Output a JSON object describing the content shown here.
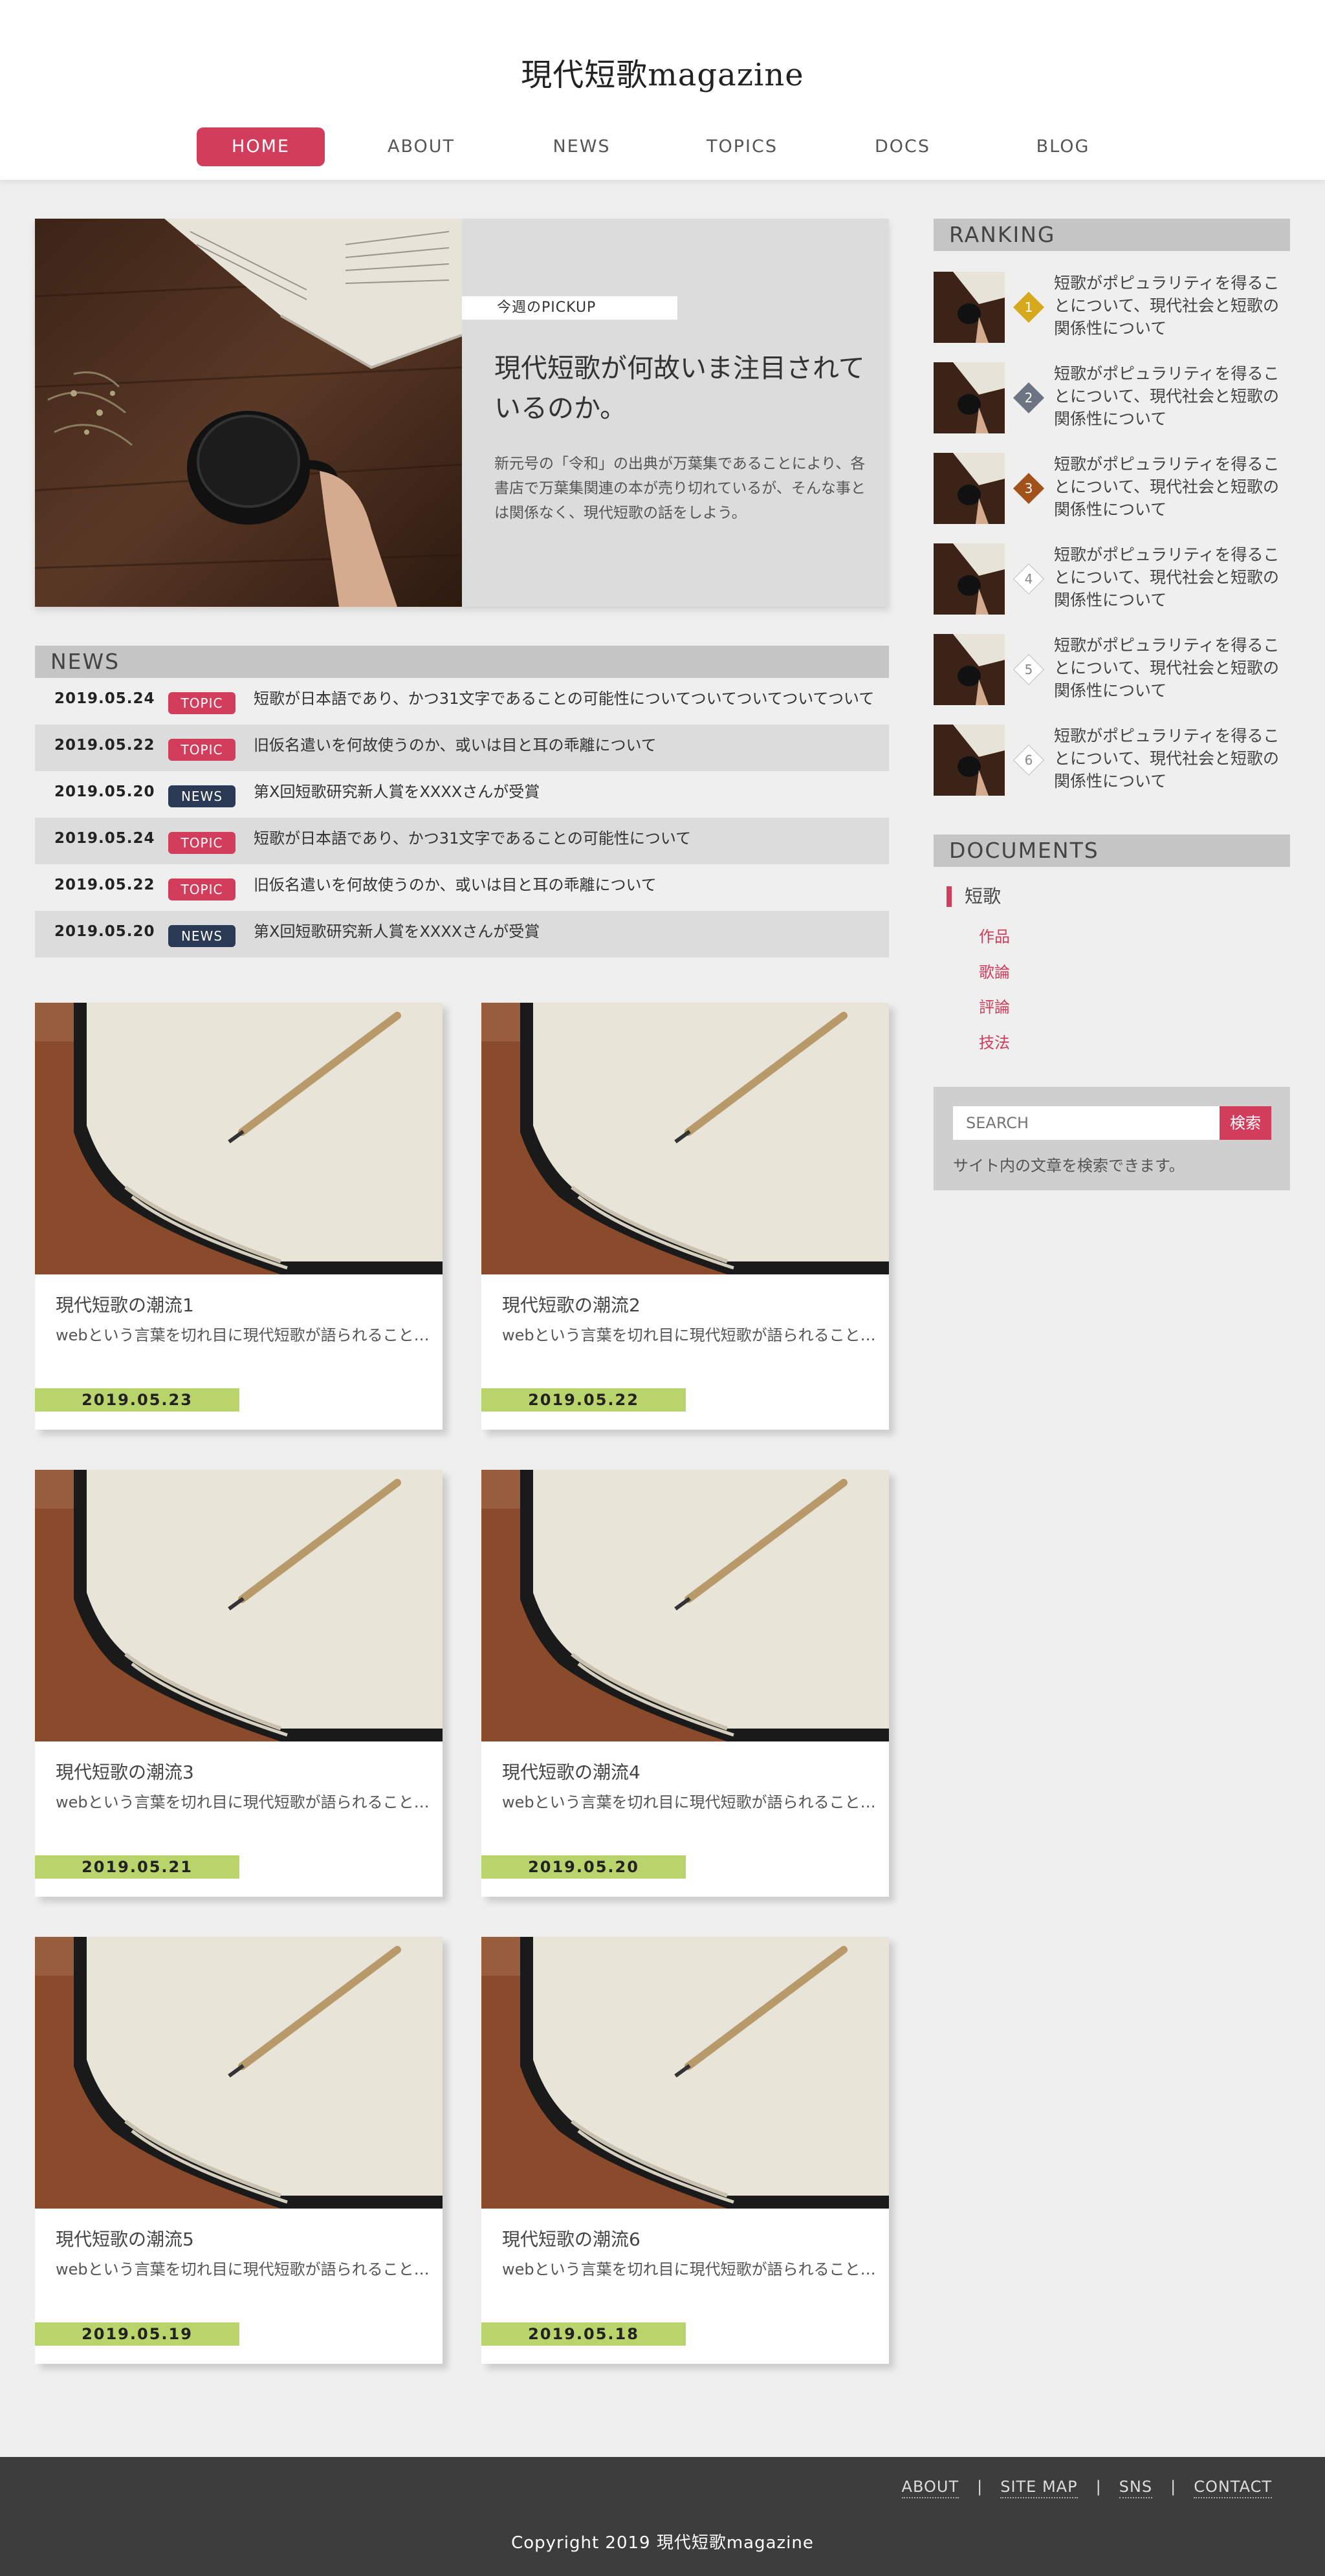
{
  "site": {
    "title": "現代短歌magazine"
  },
  "nav": [
    "HOME",
    "ABOUT",
    "NEWS",
    "TOPICS",
    "DOCS",
    "BLOG"
  ],
  "pickup": {
    "tag": "今週のPICKUP",
    "headline": "現代短歌が何故いま注目されているのか。",
    "description": "新元号の「令和」の出典が万葉集であることにより、各書店で万葉集関連の本が売り切れているが、そんな事とは関係なく、現代短歌の話をしよう。"
  },
  "news": {
    "heading": "NEWS",
    "items": [
      {
        "date": "2019.05.24",
        "badge": "TOPIC",
        "text": "短歌が日本語であり、かつ31文字であることの可能性についてついてついてついてついて"
      },
      {
        "date": "2019.05.22",
        "badge": "TOPIC",
        "text": "旧仮名遣いを何故使うのか、或いは目と耳の乖離について"
      },
      {
        "date": "2019.05.20",
        "badge": "NEWS",
        "text": "第X回短歌研究新人賞をXXXXさんが受賞"
      },
      {
        "date": "2019.05.24",
        "badge": "TOPIC",
        "text": "短歌が日本語であり、かつ31文字であることの可能性について"
      },
      {
        "date": "2019.05.22",
        "badge": "TOPIC",
        "text": "旧仮名遣いを何故使うのか、或いは目と耳の乖離について"
      },
      {
        "date": "2019.05.20",
        "badge": "NEWS",
        "text": "第X回短歌研究新人賞をXXXXさんが受賞"
      }
    ]
  },
  "cards": [
    {
      "title": "現代短歌の潮流1",
      "excerpt": "webという言葉を切れ目に現代短歌が語られることが多くなった",
      "date": "2019.05.23"
    },
    {
      "title": "現代短歌の潮流2",
      "excerpt": "webという言葉を切れ目に現代短歌が語られることが多くなった",
      "date": "2019.05.22"
    },
    {
      "title": "現代短歌の潮流3",
      "excerpt": "webという言葉を切れ目に現代短歌が語られることが多くなった",
      "date": "2019.05.21"
    },
    {
      "title": "現代短歌の潮流4",
      "excerpt": "webという言葉を切れ目に現代短歌が語られることが多くなった",
      "date": "2019.05.20"
    },
    {
      "title": "現代短歌の潮流5",
      "excerpt": "webという言葉を切れ目に現代短歌が語られることが多くなった",
      "date": "2019.05.19"
    },
    {
      "title": "現代短歌の潮流6",
      "excerpt": "webという言葉を切れ目に現代短歌が語られることが多くなった",
      "date": "2019.05.18"
    }
  ],
  "ranking": {
    "heading": "RANKING",
    "items": [
      {
        "rank": "1",
        "text": "短歌がポピュラリティを得ることについて、現代社会と短歌の関係性について",
        "color": "#d6a91c"
      },
      {
        "rank": "2",
        "text": "短歌がポピュラリティを得ることについて、現代社会と短歌の関係性について",
        "color": "#6b7480"
      },
      {
        "rank": "3",
        "text": "短歌がポピュラリティを得ることについて、現代社会と短歌の関係性について",
        "color": "#a0521a"
      },
      {
        "rank": "4",
        "text": "短歌がポピュラリティを得ることについて、現代社会と短歌の関係性について",
        "color": "#ffffff"
      },
      {
        "rank": "5",
        "text": "短歌がポピュラリティを得ることについて、現代社会と短歌の関係性について",
        "color": "#ffffff"
      },
      {
        "rank": "6",
        "text": "短歌がポピュラリティを得ることについて、現代社会と短歌の関係性について",
        "color": "#ffffff"
      }
    ]
  },
  "documents": {
    "heading": "DOCUMENTS",
    "category": "短歌",
    "links": [
      "作品",
      "歌論",
      "評論",
      "技法"
    ]
  },
  "search": {
    "placeholder": "SEARCH",
    "button": "検索",
    "note": "サイト内の文章を検索できます。"
  },
  "footer": {
    "links": [
      "ABOUT",
      "SITE MAP",
      "SNS",
      "CONTACT"
    ],
    "separator": "|",
    "copyright": "Copyright 2019 現代短歌magazine"
  },
  "colors": {
    "accent": "#d13d5b",
    "news_badge": "#2a3a55",
    "date_bar": "#b8d46a",
    "footer_bg": "#3d3d3d"
  }
}
